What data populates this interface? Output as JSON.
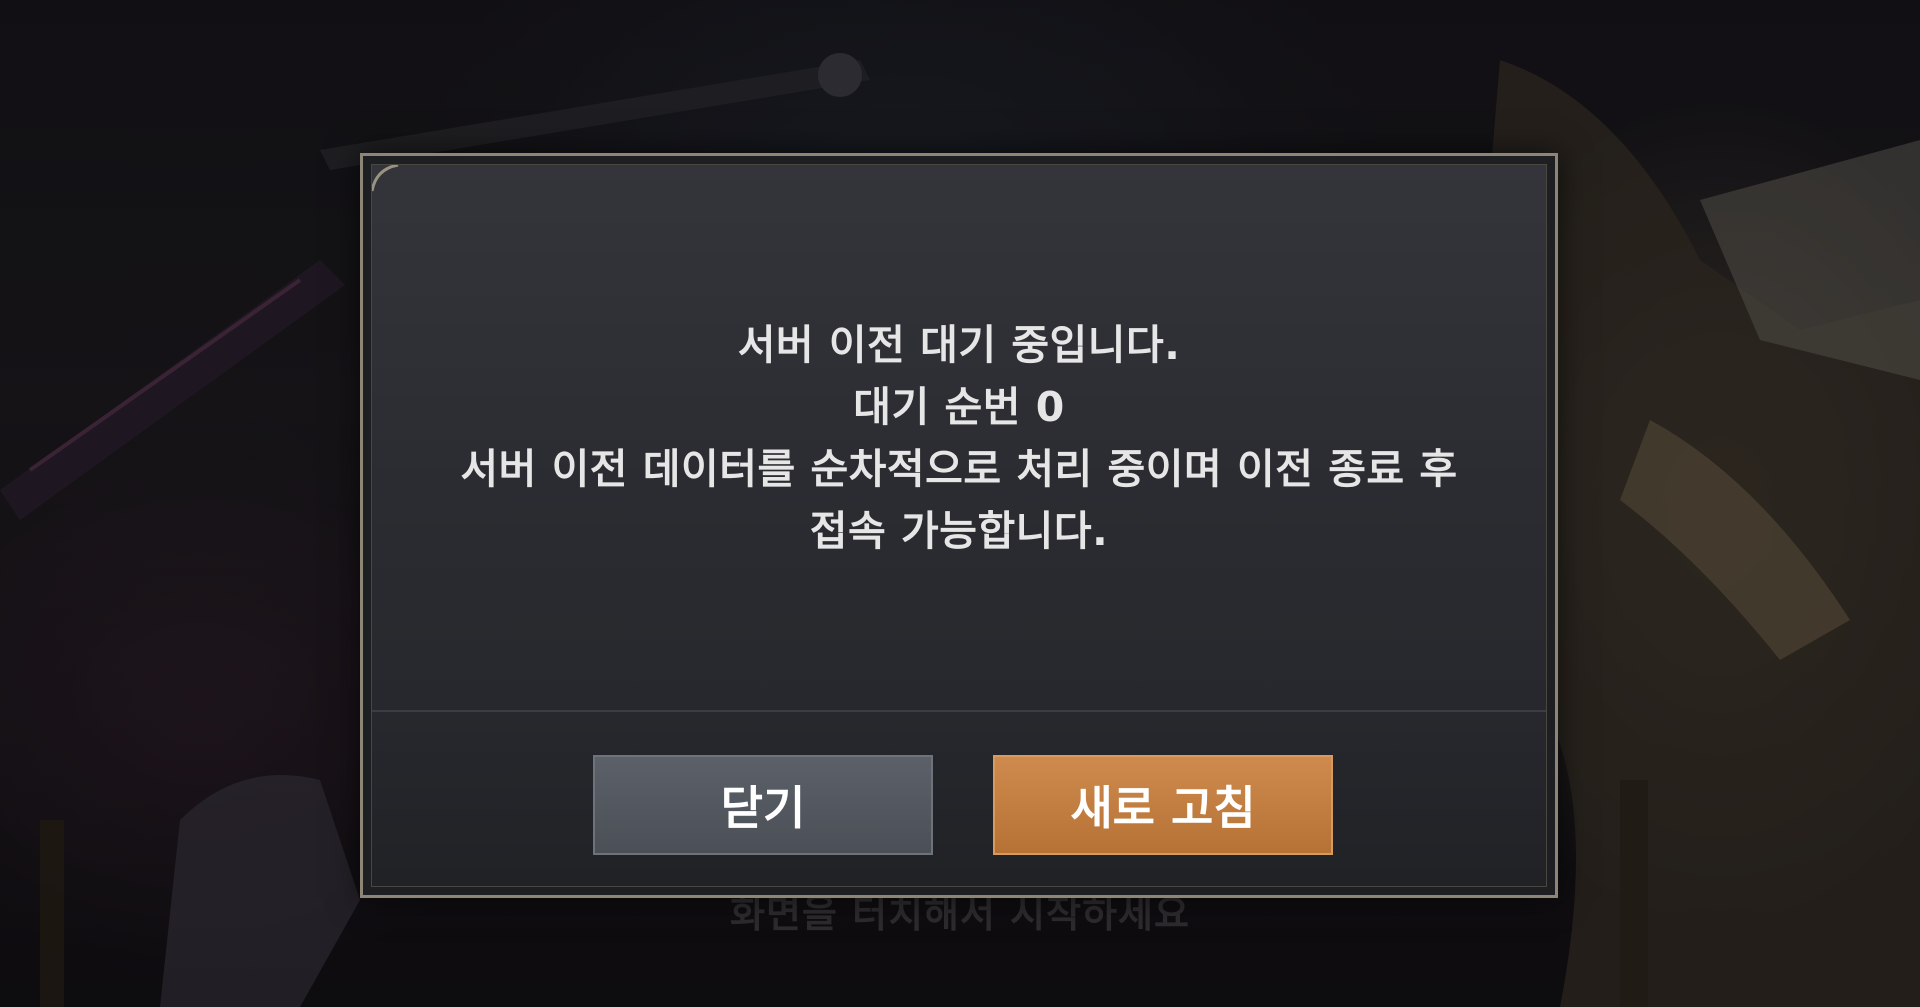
{
  "background": {
    "hint_text": "화면을 터치해서 시작하세요"
  },
  "dialog": {
    "message_lines": [
      "서버 이전 대기 중입니다.",
      "대기 순번 0",
      "서버 이전 데이터를 순차적으로 처리 중이며 이전 종료 후",
      "접속 가능합니다."
    ],
    "close_label": "닫기",
    "refresh_label": "새로 고침"
  },
  "colors": {
    "refresh_button": "#c27d42",
    "close_button": "#545860",
    "frame_border": "#8d8576",
    "panel": "#2a2c31"
  }
}
